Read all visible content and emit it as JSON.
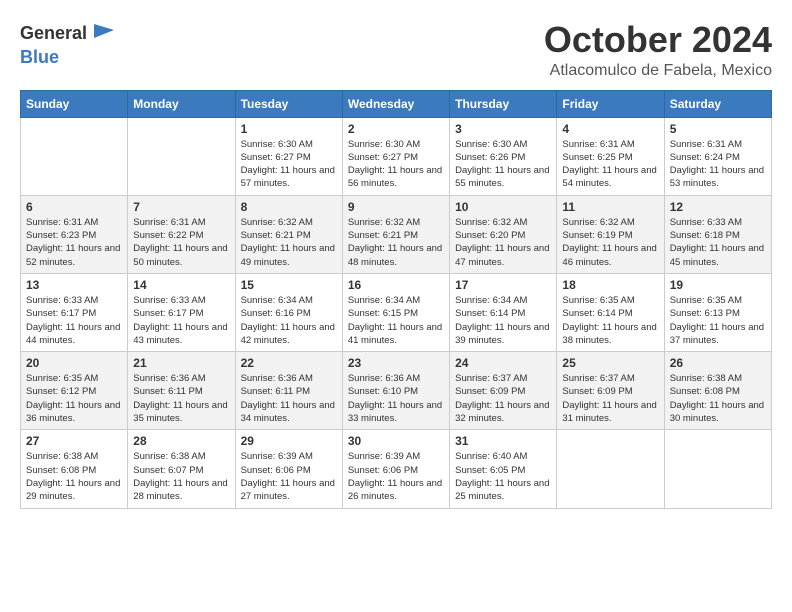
{
  "logo": {
    "line1": "General",
    "line2": "Blue"
  },
  "title": "October 2024",
  "subtitle": "Atlacomulco de Fabela, Mexico",
  "weekdays": [
    "Sunday",
    "Monday",
    "Tuesday",
    "Wednesday",
    "Thursday",
    "Friday",
    "Saturday"
  ],
  "weeks": [
    [
      {
        "day": null
      },
      {
        "day": null
      },
      {
        "day": "1",
        "sunrise": "Sunrise: 6:30 AM",
        "sunset": "Sunset: 6:27 PM",
        "daylight": "Daylight: 11 hours and 57 minutes."
      },
      {
        "day": "2",
        "sunrise": "Sunrise: 6:30 AM",
        "sunset": "Sunset: 6:27 PM",
        "daylight": "Daylight: 11 hours and 56 minutes."
      },
      {
        "day": "3",
        "sunrise": "Sunrise: 6:30 AM",
        "sunset": "Sunset: 6:26 PM",
        "daylight": "Daylight: 11 hours and 55 minutes."
      },
      {
        "day": "4",
        "sunrise": "Sunrise: 6:31 AM",
        "sunset": "Sunset: 6:25 PM",
        "daylight": "Daylight: 11 hours and 54 minutes."
      },
      {
        "day": "5",
        "sunrise": "Sunrise: 6:31 AM",
        "sunset": "Sunset: 6:24 PM",
        "daylight": "Daylight: 11 hours and 53 minutes."
      }
    ],
    [
      {
        "day": "6",
        "sunrise": "Sunrise: 6:31 AM",
        "sunset": "Sunset: 6:23 PM",
        "daylight": "Daylight: 11 hours and 52 minutes."
      },
      {
        "day": "7",
        "sunrise": "Sunrise: 6:31 AM",
        "sunset": "Sunset: 6:22 PM",
        "daylight": "Daylight: 11 hours and 50 minutes."
      },
      {
        "day": "8",
        "sunrise": "Sunrise: 6:32 AM",
        "sunset": "Sunset: 6:21 PM",
        "daylight": "Daylight: 11 hours and 49 minutes."
      },
      {
        "day": "9",
        "sunrise": "Sunrise: 6:32 AM",
        "sunset": "Sunset: 6:21 PM",
        "daylight": "Daylight: 11 hours and 48 minutes."
      },
      {
        "day": "10",
        "sunrise": "Sunrise: 6:32 AM",
        "sunset": "Sunset: 6:20 PM",
        "daylight": "Daylight: 11 hours and 47 minutes."
      },
      {
        "day": "11",
        "sunrise": "Sunrise: 6:32 AM",
        "sunset": "Sunset: 6:19 PM",
        "daylight": "Daylight: 11 hours and 46 minutes."
      },
      {
        "day": "12",
        "sunrise": "Sunrise: 6:33 AM",
        "sunset": "Sunset: 6:18 PM",
        "daylight": "Daylight: 11 hours and 45 minutes."
      }
    ],
    [
      {
        "day": "13",
        "sunrise": "Sunrise: 6:33 AM",
        "sunset": "Sunset: 6:17 PM",
        "daylight": "Daylight: 11 hours and 44 minutes."
      },
      {
        "day": "14",
        "sunrise": "Sunrise: 6:33 AM",
        "sunset": "Sunset: 6:17 PM",
        "daylight": "Daylight: 11 hours and 43 minutes."
      },
      {
        "day": "15",
        "sunrise": "Sunrise: 6:34 AM",
        "sunset": "Sunset: 6:16 PM",
        "daylight": "Daylight: 11 hours and 42 minutes."
      },
      {
        "day": "16",
        "sunrise": "Sunrise: 6:34 AM",
        "sunset": "Sunset: 6:15 PM",
        "daylight": "Daylight: 11 hours and 41 minutes."
      },
      {
        "day": "17",
        "sunrise": "Sunrise: 6:34 AM",
        "sunset": "Sunset: 6:14 PM",
        "daylight": "Daylight: 11 hours and 39 minutes."
      },
      {
        "day": "18",
        "sunrise": "Sunrise: 6:35 AM",
        "sunset": "Sunset: 6:14 PM",
        "daylight": "Daylight: 11 hours and 38 minutes."
      },
      {
        "day": "19",
        "sunrise": "Sunrise: 6:35 AM",
        "sunset": "Sunset: 6:13 PM",
        "daylight": "Daylight: 11 hours and 37 minutes."
      }
    ],
    [
      {
        "day": "20",
        "sunrise": "Sunrise: 6:35 AM",
        "sunset": "Sunset: 6:12 PM",
        "daylight": "Daylight: 11 hours and 36 minutes."
      },
      {
        "day": "21",
        "sunrise": "Sunrise: 6:36 AM",
        "sunset": "Sunset: 6:11 PM",
        "daylight": "Daylight: 11 hours and 35 minutes."
      },
      {
        "day": "22",
        "sunrise": "Sunrise: 6:36 AM",
        "sunset": "Sunset: 6:11 PM",
        "daylight": "Daylight: 11 hours and 34 minutes."
      },
      {
        "day": "23",
        "sunrise": "Sunrise: 6:36 AM",
        "sunset": "Sunset: 6:10 PM",
        "daylight": "Daylight: 11 hours and 33 minutes."
      },
      {
        "day": "24",
        "sunrise": "Sunrise: 6:37 AM",
        "sunset": "Sunset: 6:09 PM",
        "daylight": "Daylight: 11 hours and 32 minutes."
      },
      {
        "day": "25",
        "sunrise": "Sunrise: 6:37 AM",
        "sunset": "Sunset: 6:09 PM",
        "daylight": "Daylight: 11 hours and 31 minutes."
      },
      {
        "day": "26",
        "sunrise": "Sunrise: 6:38 AM",
        "sunset": "Sunset: 6:08 PM",
        "daylight": "Daylight: 11 hours and 30 minutes."
      }
    ],
    [
      {
        "day": "27",
        "sunrise": "Sunrise: 6:38 AM",
        "sunset": "Sunset: 6:08 PM",
        "daylight": "Daylight: 11 hours and 29 minutes."
      },
      {
        "day": "28",
        "sunrise": "Sunrise: 6:38 AM",
        "sunset": "Sunset: 6:07 PM",
        "daylight": "Daylight: 11 hours and 28 minutes."
      },
      {
        "day": "29",
        "sunrise": "Sunrise: 6:39 AM",
        "sunset": "Sunset: 6:06 PM",
        "daylight": "Daylight: 11 hours and 27 minutes."
      },
      {
        "day": "30",
        "sunrise": "Sunrise: 6:39 AM",
        "sunset": "Sunset: 6:06 PM",
        "daylight": "Daylight: 11 hours and 26 minutes."
      },
      {
        "day": "31",
        "sunrise": "Sunrise: 6:40 AM",
        "sunset": "Sunset: 6:05 PM",
        "daylight": "Daylight: 11 hours and 25 minutes."
      },
      {
        "day": null
      },
      {
        "day": null
      }
    ]
  ]
}
